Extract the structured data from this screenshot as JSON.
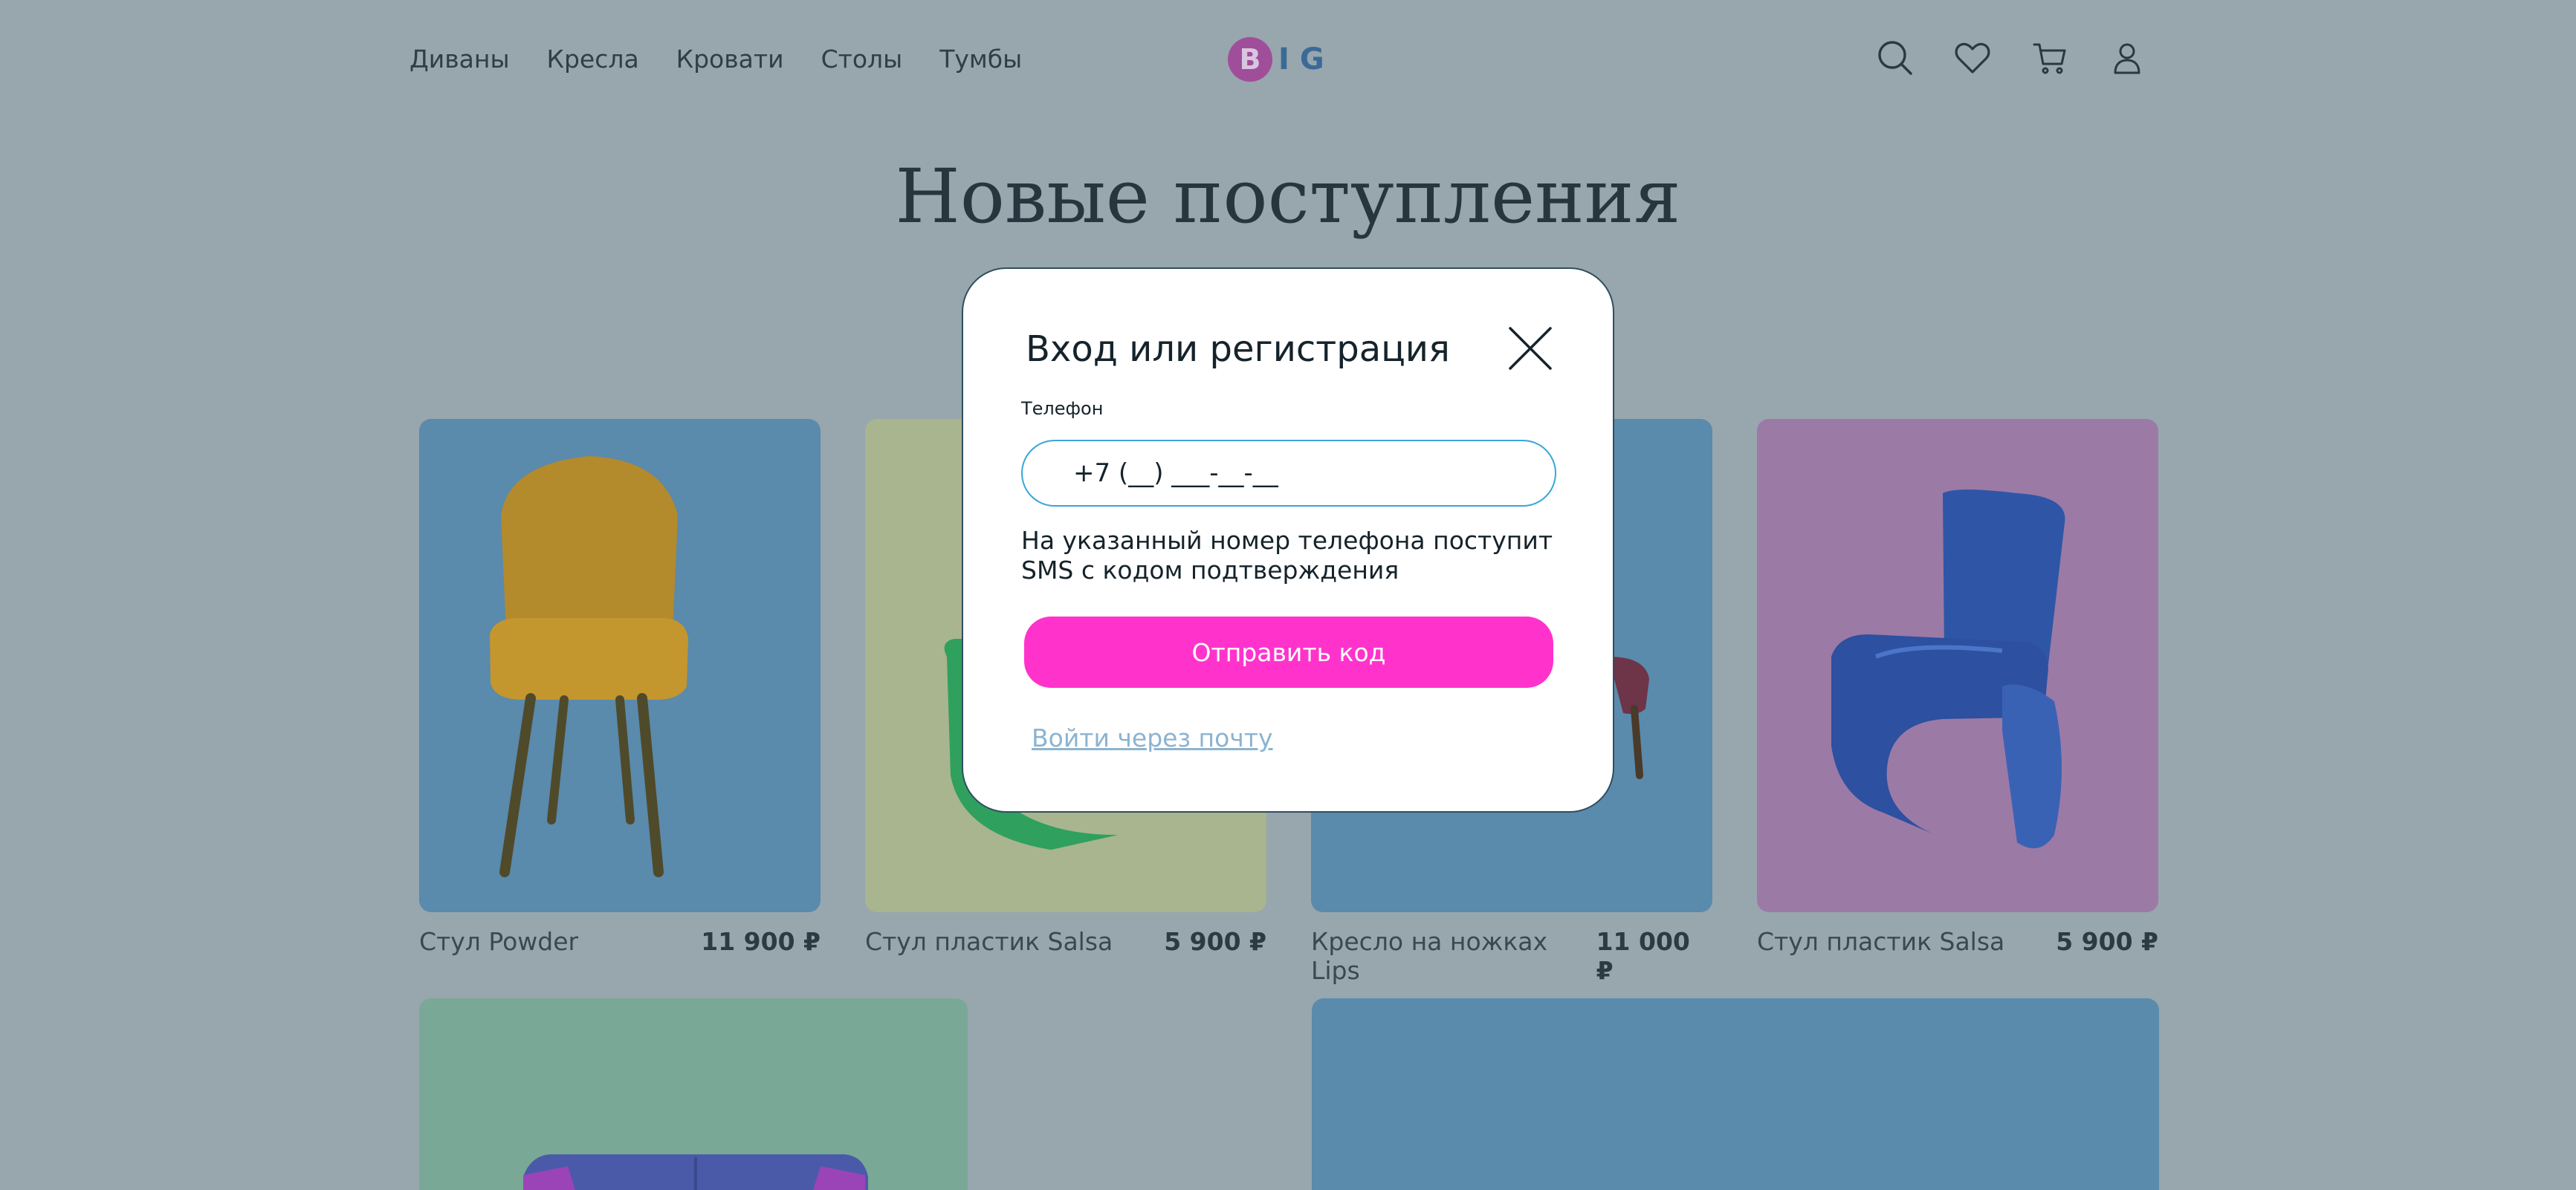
{
  "header": {
    "nav": [
      "Диваны",
      "Кресла",
      "Кровати",
      "Столы",
      "Тумбы"
    ],
    "logo_letters": [
      "B",
      "I",
      "G"
    ]
  },
  "icons": [
    "search-icon",
    "heart-icon",
    "cart-icon",
    "user-icon"
  ],
  "page_title": "Новые поступления",
  "products": [
    {
      "name": "Стул Powder",
      "price": "11 900 ₽",
      "bg": "#5a8aac"
    },
    {
      "name": "Стул пластик Salsa",
      "price": "5 900 ₽",
      "bg": "#a8b58e"
    },
    {
      "name": "Кресло на ножках Lips",
      "price": "11 000 ₽",
      "bg": "#5a8aac"
    },
    {
      "name": "Стул пластик Salsa",
      "price": "5 900 ₽",
      "bg": "#9c7aa6"
    }
  ],
  "colors": {
    "overlay_bg": "#98a6ae",
    "accent": "#ff33cc",
    "input_border": "#3aa6d8",
    "link": "#8cb3d1"
  },
  "modal": {
    "title": "Вход или регистрация",
    "phone_label": "Телефон",
    "phone_value": "+7 (__) ___-__-__",
    "hint": "На указанный номер телефона поступит SMS с кодом подтверждения",
    "send_button": "Отправить код",
    "email_link": "Войти через почту"
  }
}
